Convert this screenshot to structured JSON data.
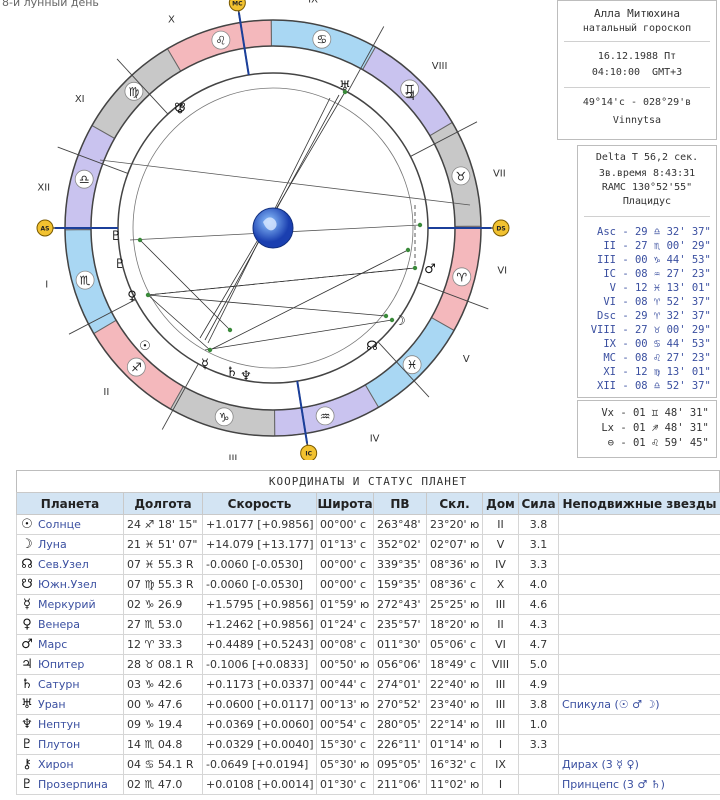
{
  "lunar_day": "8-й лунный день",
  "header": {
    "name": "Алла Митюхина",
    "chart_type": "натальный гороскоп",
    "date": "16.12.1988 Пт",
    "time": "04:10:00",
    "tz": "GMT+3",
    "coords": "49°14'с - 028°29'в",
    "city": "Vinnytsa"
  },
  "calc": {
    "delta_t": "Delta T  56,2 сек.",
    "star_time": "Зв.время 8:43:31",
    "ramc": "RAMC 130°52'55\"",
    "system": "Плацидус"
  },
  "houses": [
    {
      "name": "Asc",
      "value": "29 ♎ 32' 37\""
    },
    {
      "name": "II",
      "value": "27 ♏ 00' 29\""
    },
    {
      "name": "III",
      "value": "00 ♑ 44' 53\""
    },
    {
      "name": "IC",
      "value": "08 ♒ 27' 23\""
    },
    {
      "name": "V",
      "value": "12 ♓ 13' 01\""
    },
    {
      "name": "VI",
      "value": "08 ♈ 52' 37\""
    },
    {
      "name": "Dsc",
      "value": "29 ♈ 32' 37\""
    },
    {
      "name": "VIII",
      "value": "27 ♉ 00' 29\""
    },
    {
      "name": "IX",
      "value": "00 ♋ 44' 53\""
    },
    {
      "name": "MC",
      "value": "08 ♌ 27' 23\""
    },
    {
      "name": "XI",
      "value": "12 ♍ 13' 01\""
    },
    {
      "name": "XII",
      "value": "08 ♎ 52' 37\""
    }
  ],
  "nodes": [
    {
      "name": "Vx",
      "value": "01 ♊ 48' 31\""
    },
    {
      "name": "Lx",
      "value": "01 ♐ 48' 31\""
    },
    {
      "name": "⊖",
      "value": "01 ♌ 59' 45\""
    }
  ],
  "wheel": {
    "houses_roman": [
      "I",
      "II",
      "III",
      "IV",
      "V",
      "VI",
      "VII",
      "VIII",
      "IX",
      "X",
      "XI",
      "XII"
    ],
    "angle_badges": [
      "AS",
      "DS",
      "MC",
      "IC"
    ],
    "sign_glyphs": [
      "♈",
      "♉",
      "♊",
      "♋",
      "♌",
      "♍",
      "♎",
      "♏",
      "♐",
      "♑",
      "♒",
      "♓"
    ],
    "planet_glyphs": [
      "☉",
      "☽",
      "☊",
      "☋",
      "☿",
      "♀",
      "♂",
      "♃",
      "♄",
      "♅",
      "♆",
      "♇",
      "⚷",
      "♇"
    ]
  },
  "table": {
    "title": "КООРДИНАТЫ И СТАТУС ПЛАНЕТ",
    "headers": [
      "Планета",
      "Долгота",
      "Скорость",
      "Широта",
      "ПВ",
      "Скл.",
      "Дом",
      "Сила",
      "Неподвижные звезды"
    ],
    "rows": [
      {
        "glyph": "☉",
        "name": "Солнце",
        "lon": "24 ♐ 18' 15\"",
        "speed": "+1.0177  [+0.9856]",
        "lat": "00°00' с",
        "ra": "263°48'",
        "dec": "23°20' ю",
        "house": "II",
        "power": "3.8",
        "star": ""
      },
      {
        "glyph": "☽",
        "name": "Луна",
        "lon": "21 ♓ 51' 07\"",
        "speed": "+14.079  [+13.177]",
        "lat": "01°13' с",
        "ra": "352°02'",
        "dec": "02°07' ю",
        "house": "V",
        "power": "3.1",
        "star": ""
      },
      {
        "glyph": "☊",
        "name": "Сев.Узел",
        "lon": "07 ♓ 55.3  R",
        "speed": "-0.0060  [-0.0530]",
        "lat": "00°00' с",
        "ra": "339°35'",
        "dec": "08°36' ю",
        "house": "IV",
        "power": "3.3",
        "star": ""
      },
      {
        "glyph": "☋",
        "name": "Южн.Узел",
        "lon": "07 ♍ 55.3  R",
        "speed": "-0.0060  [-0.0530]",
        "lat": "00°00' с",
        "ra": "159°35'",
        "dec": "08°36' с",
        "house": "X",
        "power": "4.0",
        "star": ""
      },
      {
        "glyph": "☿",
        "name": "Меркурий",
        "lon": "02 ♑ 26.9",
        "speed": "+1.5795  [+0.9856]",
        "lat": "01°59' ю",
        "ra": "272°43'",
        "dec": "25°25' ю",
        "house": "III",
        "power": "4.6",
        "star": ""
      },
      {
        "glyph": "♀",
        "name": "Венера",
        "lon": "27 ♏ 53.0",
        "speed": "+1.2462  [+0.9856]",
        "lat": "01°24' с",
        "ra": "235°57'",
        "dec": "18°20' ю",
        "house": "II",
        "power": "4.3",
        "star": ""
      },
      {
        "glyph": "♂",
        "name": "Марс",
        "lon": "12 ♈ 33.3",
        "speed": "+0.4489  [+0.5243]",
        "lat": "00°08' с",
        "ra": "011°30'",
        "dec": "05°06' с",
        "house": "VI",
        "power": "4.7",
        "star": ""
      },
      {
        "glyph": "♃",
        "name": "Юпитер",
        "lon": "28 ♉ 08.1  R",
        "speed": "-0.1006  [+0.0833]",
        "lat": "00°50' ю",
        "ra": "056°06'",
        "dec": "18°49' с",
        "house": "VIII",
        "power": "5.0",
        "star": ""
      },
      {
        "glyph": "♄",
        "name": "Сатурн",
        "lon": "03 ♑ 42.6",
        "speed": "+0.1173  [+0.0337]",
        "lat": "00°44' с",
        "ra": "274°01'",
        "dec": "22°40' ю",
        "house": "III",
        "power": "4.9",
        "star": ""
      },
      {
        "glyph": "♅",
        "name": "Уран",
        "lon": "00 ♑ 47.6",
        "speed": "+0.0600  [+0.0117]",
        "lat": "00°13' ю",
        "ra": "270°52'",
        "dec": "23°40' ю",
        "house": "III",
        "power": "3.8",
        "star": "Спикула (☉ ♂ ☽)"
      },
      {
        "glyph": "♆",
        "name": "Нептун",
        "lon": "09 ♑ 19.4",
        "speed": "+0.0369  [+0.0060]",
        "lat": "00°54' с",
        "ra": "280°05'",
        "dec": "22°14' ю",
        "house": "III",
        "power": "1.0",
        "star": ""
      },
      {
        "glyph": "♇",
        "name": "Плутон",
        "lon": "14 ♏ 04.8",
        "speed": "+0.0329  [+0.0040]",
        "lat": "15°30' с",
        "ra": "226°11'",
        "dec": "01°14' ю",
        "house": "I",
        "power": "3.3",
        "star": ""
      },
      {
        "glyph": "⚷",
        "name": "Хирон",
        "lon": "04 ♋ 54.1  R",
        "speed": "-0.0649  [+0.0194]",
        "lat": "05°30' ю",
        "ra": "095°05'",
        "dec": "16°32' с",
        "house": "IX",
        "power": "",
        "star": "Дирах (3 ☿ ♀)"
      },
      {
        "glyph": "♇",
        "name": "Прозерпина",
        "lon": "02 ♏ 47.0",
        "speed": "+0.0108  [+0.0014]",
        "lat": "01°30' с",
        "ra": "211°06'",
        "dec": "11°02' ю",
        "house": "I",
        "power": "",
        "star": "Принцепс (3 ♂ ♄)"
      }
    ]
  },
  "colors": {
    "ring_blue": "#a9d7f3",
    "ring_pink": "#f4b8bc",
    "ring_gray": "#c8c8c8",
    "ring_lilac": "#c9c3ef",
    "header_bg": "#d3e4f3",
    "link_blue": "#3a4fa0"
  }
}
